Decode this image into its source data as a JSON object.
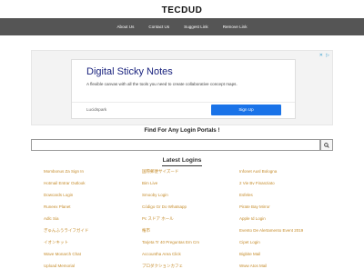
{
  "site": {
    "title": "TECDUD"
  },
  "nav": {
    "items": [
      {
        "label": "About Us"
      },
      {
        "label": "Contact Us"
      },
      {
        "label": "Suggest Link"
      },
      {
        "label": "Remove Link"
      }
    ]
  },
  "ad": {
    "headline": "Digital Sticky Notes",
    "description": "A flexible canvas with all the tools you need to create collaborative concept maps.",
    "brand": "Lucidspark",
    "cta": "Sign Up",
    "choices_icon": "ad-choices-icon",
    "close_icon": "close-icon"
  },
  "search": {
    "heading": "Find For Any Login Portals !",
    "placeholder": "",
    "button_icon": "search-icon"
  },
  "latest": {
    "heading": "Latest Logins",
    "columns": [
      [
        "Mombonus Za Sign In",
        "Hotmail Entrar Outlook",
        "Dowcards Login",
        "Runeex Planet",
        "Adlc Sia",
        "ぎゅんふうライフガイド",
        "イオンキット",
        "Wave Monarch Chat",
        "Upload Memorial"
      ],
      [
        "国際郵便サイズード",
        "Bim Live",
        "Smooby Login",
        "Código Gr Do Whatsapp",
        "Pc スドア ホール",
        "権市",
        "Tarjeta Tr 40 Preguntas Em Cm",
        "Accountha Area Click",
        "プロダクションカフェ"
      ],
      [
        "Infonet Ausl Bologna",
        "2 Vie Bv Finanziato",
        "Esfeles",
        "Pirate Bay Mirror",
        "Apple Id Login",
        "Evento De Alertamento Event 2019",
        "Cipet Login",
        "Bigbite Mail",
        "Www Atos Mail"
      ]
    ]
  },
  "colors": {
    "nav_bg": "#555555",
    "link": "#c58b2a",
    "ad_cta": "#1a73e8",
    "ad_headline": "#1a237e"
  }
}
